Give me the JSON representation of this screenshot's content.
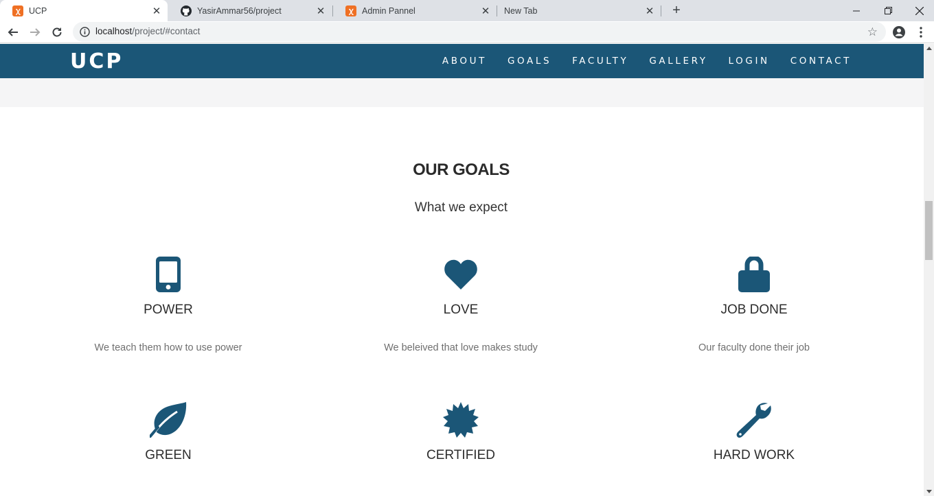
{
  "browser": {
    "tabs": [
      {
        "title": "UCP",
        "active": true,
        "favicon": "xampp-icon"
      },
      {
        "title": "YasirAmmar56/project",
        "active": false,
        "favicon": "github-icon"
      },
      {
        "title": "Admin Pannel",
        "active": false,
        "favicon": "xampp-icon"
      },
      {
        "title": "New Tab",
        "active": false,
        "favicon": ""
      }
    ],
    "url_host": "localhost",
    "url_path": "/project/#contact"
  },
  "site": {
    "brand": "UCP",
    "menu": [
      "ABOUT",
      "GOALS",
      "FACULTY",
      "GALLERY",
      "LOGIN",
      "CONTACT"
    ],
    "accent_color": "#1b5677"
  },
  "goals": {
    "title": "OUR GOALS",
    "subtitle": "What we expect",
    "items": [
      {
        "icon": "mobile-icon",
        "title": "POWER",
        "text": "We teach them how to use power"
      },
      {
        "icon": "heart-icon",
        "title": "LOVE",
        "text": "We beleived that love makes study"
      },
      {
        "icon": "lock-icon",
        "title": "JOB DONE",
        "text": "Our faculty done their job"
      },
      {
        "icon": "leaf-icon",
        "title": "GREEN",
        "text": ""
      },
      {
        "icon": "certificate-icon",
        "title": "CERTIFIED",
        "text": ""
      },
      {
        "icon": "wrench-icon",
        "title": "HARD WORK",
        "text": ""
      }
    ]
  }
}
